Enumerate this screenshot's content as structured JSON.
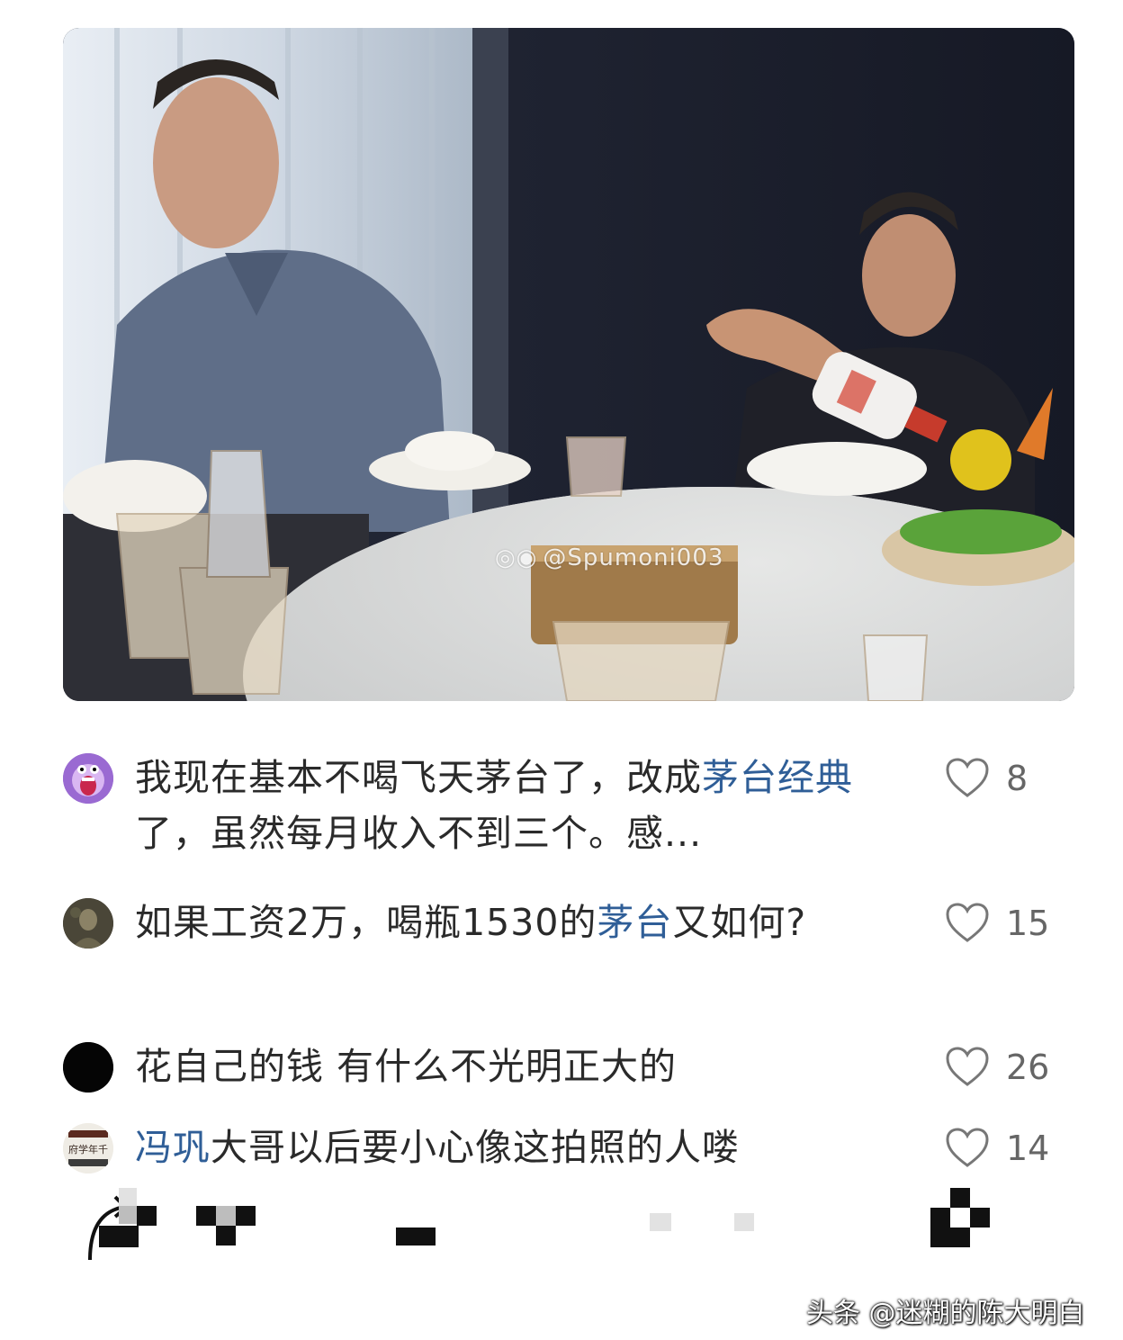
{
  "photo": {
    "watermark": "@Spumoni003",
    "watermark_icon": "weibo-logo-icon"
  },
  "comments": [
    {
      "avatar": "purple-cartoon-avatar",
      "text_before": "我现在基本不喝飞天茅台了，改成",
      "highlight": "茅台经典",
      "text_after": "了，虽然每月收入不到三个。感...",
      "likes": "8"
    },
    {
      "avatar": "dark-photo-avatar",
      "text_before": "如果工资2万，喝瓶1530的",
      "highlight": "茅台",
      "text_after": "又如何?",
      "likes": "15"
    },
    {
      "avatar": "black-circle-avatar",
      "text_before": "花自己的钱 有什么不光明正大的",
      "highlight": "",
      "text_after": "",
      "likes": "26"
    },
    {
      "avatar": "calligraphy-avatar",
      "avatar_text": "府学年千",
      "text_before": "",
      "highlight": "冯巩",
      "text_after": "大哥以后要小心像这拍照的人喽",
      "likes": "14"
    }
  ],
  "footer": {
    "credit": "头条 @迷糊的陈大明白"
  },
  "colors": {
    "highlight": "#2f5e97",
    "text": "#2a2a2a",
    "like_count": "#666666"
  }
}
